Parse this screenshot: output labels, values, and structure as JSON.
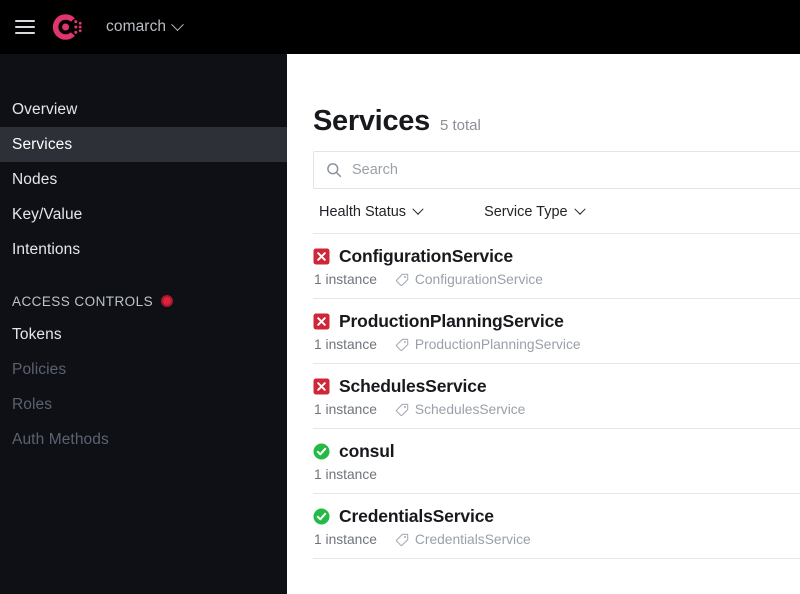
{
  "topbar": {
    "menu_icon": "hamburger-icon",
    "logo_icon": "consul-logo-icon",
    "org_name": "comarch",
    "org_chevron_icon": "chevron-down-icon",
    "background_color": "#000000"
  },
  "sidebar": {
    "background_color": "#0e1015",
    "selected_background_color": "#2e3038",
    "items": [
      {
        "label": "Overview",
        "selected": false,
        "dim": false
      },
      {
        "label": "Services",
        "selected": true,
        "dim": false
      },
      {
        "label": "Nodes",
        "selected": false,
        "dim": false
      },
      {
        "label": "Key/Value",
        "selected": false,
        "dim": false
      },
      {
        "label": "Intentions",
        "selected": false,
        "dim": false
      }
    ],
    "section": {
      "label": "ACCESS CONTROLS",
      "badge_icon": "red-dot-icon",
      "badge_color": "#d8243c"
    },
    "acl_items": [
      {
        "label": "Tokens",
        "dim": false
      },
      {
        "label": "Policies",
        "dim": true
      },
      {
        "label": "Roles",
        "dim": true
      },
      {
        "label": "Auth Methods",
        "dim": true
      }
    ]
  },
  "main": {
    "title": "Services",
    "total": "5 total",
    "search": {
      "icon": "search-icon",
      "placeholder": "Search",
      "value": ""
    },
    "filters": [
      {
        "label": "Health Status",
        "icon": "chevron-down-icon"
      },
      {
        "label": "Service Type",
        "icon": "chevron-down-icon"
      }
    ],
    "tag_icon": "tag-icon",
    "status_colors": {
      "critical": "#cf2638",
      "passing": "#25ba45"
    },
    "services": [
      {
        "name": "ConfigurationService",
        "status": "critical",
        "status_icon": "error-square-icon",
        "instances": "1 instance",
        "tag": "ConfigurationService"
      },
      {
        "name": "ProductionPlanningService",
        "status": "critical",
        "status_icon": "error-square-icon",
        "instances": "1 instance",
        "tag": "ProductionPlanningService"
      },
      {
        "name": "SchedulesService",
        "status": "critical",
        "status_icon": "error-square-icon",
        "instances": "1 instance",
        "tag": "SchedulesService"
      },
      {
        "name": "consul",
        "status": "passing",
        "status_icon": "check-circle-icon",
        "instances": "1 instance",
        "tag": ""
      },
      {
        "name": "CredentialsService",
        "status": "passing",
        "status_icon": "check-circle-icon",
        "instances": "1 instance",
        "tag": "CredentialsService"
      }
    ]
  }
}
